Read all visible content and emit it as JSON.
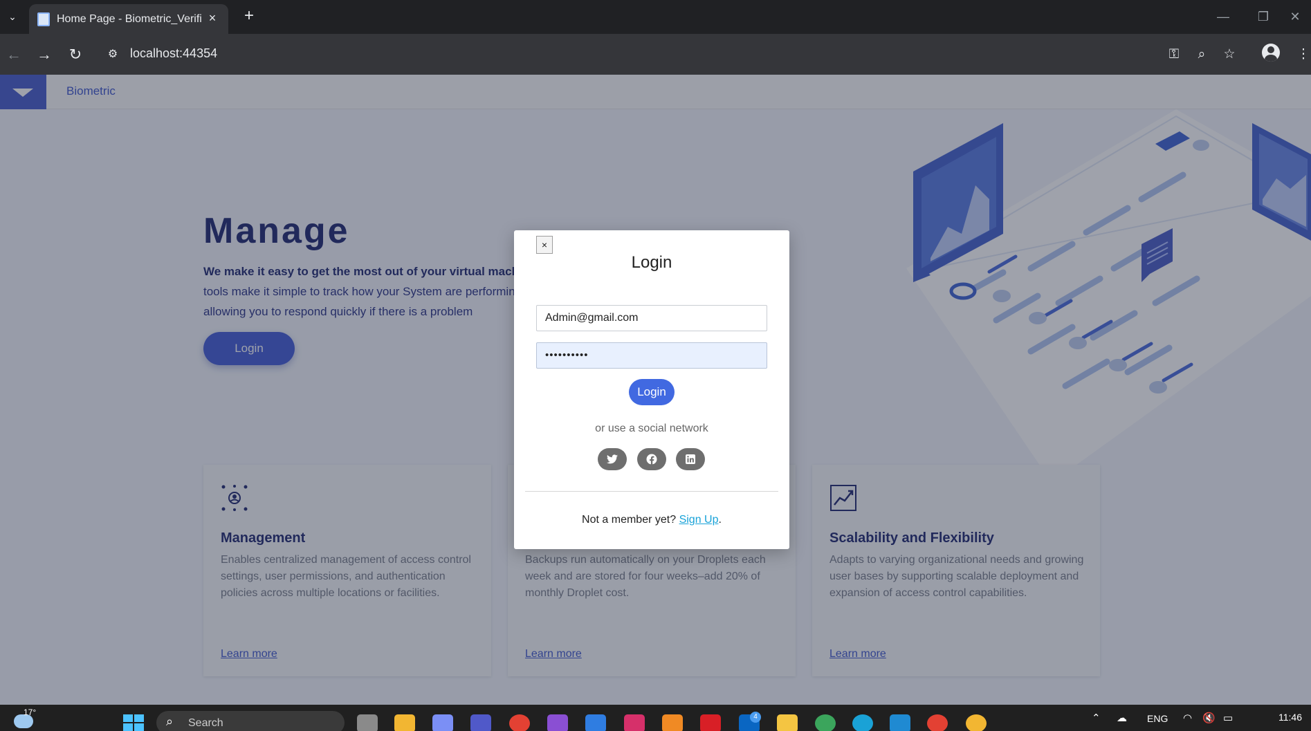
{
  "browser": {
    "tab_title": "Home Page - Biometric_Verification",
    "tab_close": "×",
    "new_tab": "+",
    "url": "localhost:44354",
    "window_controls": [
      "—",
      "❐",
      "✕"
    ]
  },
  "page": {
    "brand": "Biometric",
    "hero": {
      "title": "Manage",
      "text_bold": "We make it easy to get the most out of your virtual machines",
      "text_rest": "tools make it simple to track how your System are performing, allowing you to respond quickly if there is a problem",
      "login_label": "Login"
    },
    "cards": [
      {
        "icon": "user-focus-icon",
        "title": "Management",
        "description": "Enables centralized management of access control settings, user permissions, and authentication policies across multiple locations or facilities.",
        "link": "Learn more"
      },
      {
        "icon": "backup-icon",
        "title": "",
        "description": "Backups run automatically on your Droplets each week and are stored for four weeks–add 20% of monthly Droplet cost.",
        "link": "Learn more"
      },
      {
        "icon": "trend-chart-icon",
        "title": "Scalability and Flexibility",
        "description": "Adapts to varying organizational needs and growing user bases by supporting scalable deployment and expansion of access control capabilities.",
        "link": "Learn more"
      }
    ]
  },
  "modal": {
    "close_label": "×",
    "title": "Login",
    "email_value": "Admin@gmail.com",
    "password_value": "••••••••••",
    "login_label": "Login",
    "social_text": "or use a social network",
    "social": [
      "twitter-icon",
      "facebook-icon",
      "linkedin-icon"
    ],
    "signup_prefix": "Not a member yet?",
    "signup_link": "Sign Up",
    "signup_suffix": "."
  },
  "taskbar": {
    "weather_temp": "17°",
    "search_placeholder": "Search",
    "linkedin_badge": "4",
    "lang": "ENG",
    "time": "11:46"
  }
}
